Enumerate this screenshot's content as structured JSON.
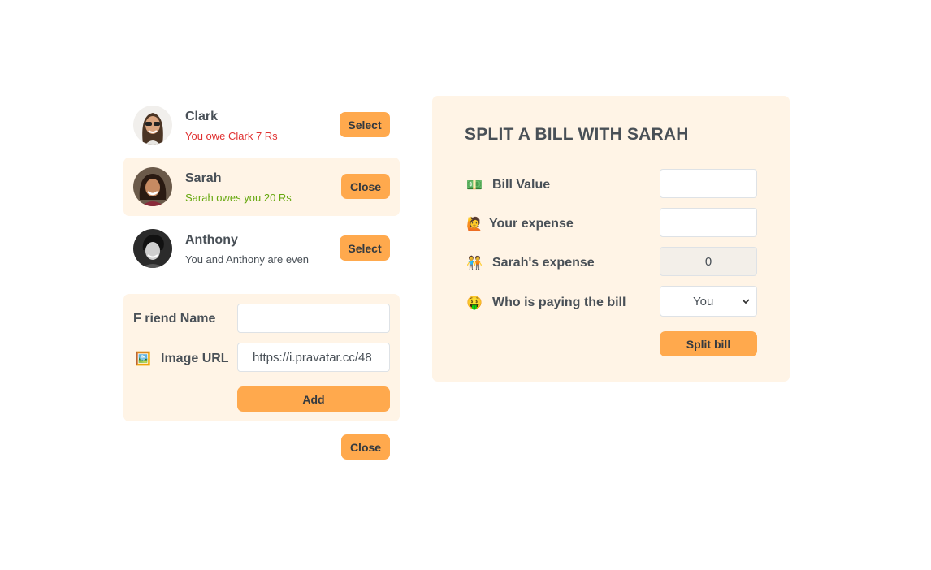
{
  "friends": [
    {
      "name": "Clark",
      "status": "You owe Clark 7 Rs",
      "button": "Select"
    },
    {
      "name": "Sarah",
      "status": "Sarah owes you 20 Rs",
      "button": "Close"
    },
    {
      "name": "Anthony",
      "status": "You and Anthony are even",
      "button": "Select"
    }
  ],
  "add_friend": {
    "name_label": "F riend Name",
    "name_value": "",
    "image_icon": "🖼️",
    "image_label": "Image URL",
    "image_value": "https://i.pravatar.cc/48",
    "add_label": "Add",
    "close_label": "Close"
  },
  "split_form": {
    "title": "SPLIT A BILL WITH SARAH",
    "bill_icon": "💵",
    "bill_label": "Bill Value",
    "bill_value": "",
    "expense_icon": "🙋",
    "expense_label": "Your expense",
    "expense_value": "",
    "friend_icon": "🧑‍🤝‍🧑",
    "friend_label": "Sarah's expense",
    "friend_value": "0",
    "payer_icon": "🤑",
    "payer_label": "Who is paying the bill",
    "payer_value": "You",
    "submit_label": "Split bill"
  },
  "colors": {
    "accent": "#ffa94d",
    "panel": "#fff4e6",
    "owe": "#e03131",
    "owed": "#66a80f"
  }
}
